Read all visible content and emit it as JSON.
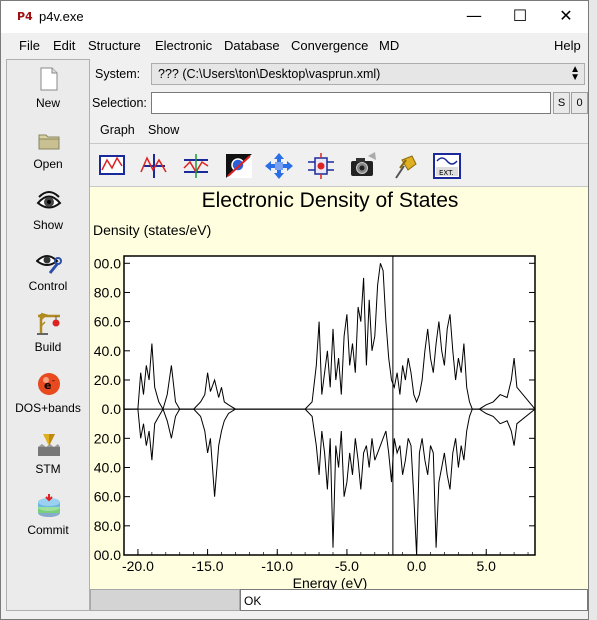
{
  "window": {
    "title": "p4v.exe",
    "app_icon_text": "P4",
    "minimize": "—",
    "maximize": "☐",
    "close": "✕"
  },
  "menu": {
    "file": "File",
    "edit": "Edit",
    "structure": "Structure",
    "electronic": "Electronic",
    "database": "Database",
    "convergence": "Convergence",
    "md": "MD",
    "help": "Help"
  },
  "sidebar": {
    "items": [
      {
        "label": "New",
        "icon": "new-document-icon"
      },
      {
        "label": "Open",
        "icon": "folder-icon"
      },
      {
        "label": "Show",
        "icon": "eye-icon"
      },
      {
        "label": "Control",
        "icon": "eye-wrench-icon"
      },
      {
        "label": "Build",
        "icon": "crane-icon"
      },
      {
        "label": "DOS+bands",
        "icon": "electron-icon"
      },
      {
        "label": "STM",
        "icon": "stm-tip-icon"
      },
      {
        "label": "Commit",
        "icon": "database-commit-icon"
      }
    ]
  },
  "system": {
    "label": "System:",
    "value": "??? (C:\\Users\\ton\\Desktop\\vasprun.xml)"
  },
  "selection": {
    "label": "Selection:",
    "value": "",
    "s_button": "S",
    "zero_button": "0"
  },
  "submenu": {
    "graph": "Graph",
    "show": "Show"
  },
  "toolbar": {
    "tools": [
      "graph-frame-icon",
      "axis-curve-icon",
      "shift-curve-icon",
      "zoom-select-icon",
      "pan-arrows-icon",
      "slider-icon",
      "camera-icon",
      "pin-icon",
      "export-icon"
    ],
    "export_text": "EXT."
  },
  "status": {
    "left": "",
    "message": "OK"
  },
  "chart_data": {
    "type": "line",
    "title": "Electronic Density of States",
    "ylabel": "Density (states/eV)",
    "xlabel": "Energy (eV)",
    "xlim": [
      -21,
      8.5
    ],
    "ylim": [
      -100,
      105
    ],
    "x_ticks": [
      -20,
      -15,
      -10,
      -5,
      0,
      5
    ],
    "x_tick_labels": [
      "-20.0",
      "-15.0",
      "-10.0",
      "-5.0",
      "0.0",
      "5.0"
    ],
    "y_ticks": [
      100,
      80,
      60,
      40,
      20,
      0,
      -20,
      -40,
      -60,
      -80,
      -100
    ],
    "y_tick_labels": [
      "00.0",
      "80.0",
      "60.0",
      "40.0",
      "20.0",
      "0.0",
      "20.0",
      "40.0",
      "60.0",
      "80.0",
      "00.0"
    ],
    "fermi_level": -1.7,
    "series": [
      {
        "x": [
          -21,
          -20.0,
          -19.8,
          -19.6,
          -19.4,
          -19.2,
          -19.0,
          -18.8,
          -18.5,
          -18.2,
          -17.9,
          -17.6,
          -17.3,
          -17.0,
          -16.0,
          -15.5,
          -15.2,
          -15.0,
          -14.8,
          -14.5,
          -14.2,
          -14.0,
          -13.8,
          -13.5,
          -13.0,
          -10.0,
          -8.0,
          -7.5,
          -7.2,
          -7.0,
          -6.8,
          -6.6,
          -6.4,
          -6.2,
          -6.0,
          -5.8,
          -5.6,
          -5.4,
          -5.2,
          -5.0,
          -4.8,
          -4.6,
          -4.4,
          -4.2,
          -4.0,
          -3.8,
          -3.6,
          -3.4,
          -3.2,
          -3.0,
          -2.8,
          -2.6,
          -2.4,
          -2.2,
          -2.0,
          -1.8,
          -1.6,
          -1.4,
          -1.2,
          -1.0,
          -0.8,
          -0.6,
          -0.4,
          -0.2,
          0.0,
          0.2,
          0.4,
          0.6,
          0.8,
          1.0,
          1.2,
          1.4,
          1.6,
          1.8,
          2.0,
          2.2,
          2.4,
          2.6,
          2.8,
          3.0,
          3.2,
          3.4,
          3.6,
          3.8,
          4.0,
          4.5,
          5.0,
          5.5,
          6.0,
          6.5,
          6.8,
          7.0,
          7.2,
          8.5
        ],
        "y": [
          0,
          0,
          25,
          10,
          30,
          20,
          45,
          15,
          5,
          0,
          10,
          30,
          5,
          0,
          0,
          5,
          10,
          25,
          12,
          20,
          8,
          15,
          5,
          3,
          0,
          0,
          0,
          5,
          30,
          60,
          10,
          25,
          40,
          15,
          55,
          20,
          35,
          10,
          50,
          65,
          30,
          45,
          25,
          70,
          60,
          90,
          30,
          75,
          40,
          50,
          85,
          100,
          95,
          60,
          35,
          20,
          15,
          25,
          10,
          30,
          20,
          35,
          25,
          10,
          5,
          10,
          20,
          40,
          55,
          35,
          25,
          45,
          60,
          40,
          30,
          55,
          65,
          40,
          20,
          35,
          25,
          45,
          15,
          5,
          0,
          0,
          3,
          5,
          10,
          8,
          20,
          35,
          15,
          0
        ]
      },
      {
        "x": [
          -21,
          -20.0,
          -19.8,
          -19.6,
          -19.4,
          -19.2,
          -19.0,
          -18.8,
          -18.5,
          -18.2,
          -17.9,
          -17.6,
          -17.3,
          -17.0,
          -16.0,
          -15.5,
          -15.2,
          -15.0,
          -14.8,
          -14.5,
          -14.2,
          -14.0,
          -13.8,
          -13.5,
          -13.0,
          -10.0,
          -8.0,
          -7.5,
          -7.2,
          -7.0,
          -6.8,
          -6.6,
          -6.4,
          -6.2,
          -6.0,
          -5.8,
          -5.6,
          -5.4,
          -5.2,
          -5.0,
          -4.8,
          -4.6,
          -4.4,
          -4.2,
          -4.0,
          -3.8,
          -3.6,
          -3.4,
          -3.2,
          -3.0,
          -2.8,
          -2.6,
          -2.4,
          -2.2,
          -2.0,
          -1.8,
          -1.6,
          -1.4,
          -1.2,
          -1.0,
          -0.8,
          -0.6,
          -0.4,
          -0.2,
          0.0,
          0.2,
          0.4,
          0.6,
          0.8,
          1.0,
          1.2,
          1.4,
          1.6,
          1.8,
          2.0,
          2.2,
          2.4,
          2.6,
          2.8,
          3.0,
          3.2,
          3.4,
          3.6,
          3.8,
          4.0,
          4.5,
          5.0,
          5.5,
          6.0,
          6.5,
          6.8,
          7.0,
          7.2,
          8.5
        ],
        "y": [
          0,
          0,
          -20,
          -10,
          -25,
          -15,
          -35,
          -10,
          -5,
          0,
          -8,
          -20,
          -5,
          0,
          0,
          -5,
          -15,
          -30,
          -20,
          -60,
          -25,
          -15,
          -8,
          -3,
          0,
          0,
          0,
          -5,
          -25,
          -45,
          -15,
          -30,
          -55,
          -20,
          -95,
          -25,
          -40,
          -15,
          -60,
          -50,
          -30,
          -45,
          -20,
          -35,
          -55,
          -30,
          -25,
          -40,
          -20,
          -35,
          -30,
          -25,
          -20,
          -15,
          -30,
          -50,
          -20,
          -30,
          -25,
          -45,
          -35,
          -20,
          -25,
          -60,
          -100,
          -30,
          -20,
          -35,
          -45,
          -25,
          -30,
          -95,
          -50,
          -40,
          -30,
          -45,
          -55,
          -30,
          -20,
          -40,
          -25,
          -35,
          -15,
          -5,
          0,
          0,
          -3,
          -5,
          -10,
          -8,
          -15,
          -25,
          -10,
          0
        ]
      }
    ]
  }
}
